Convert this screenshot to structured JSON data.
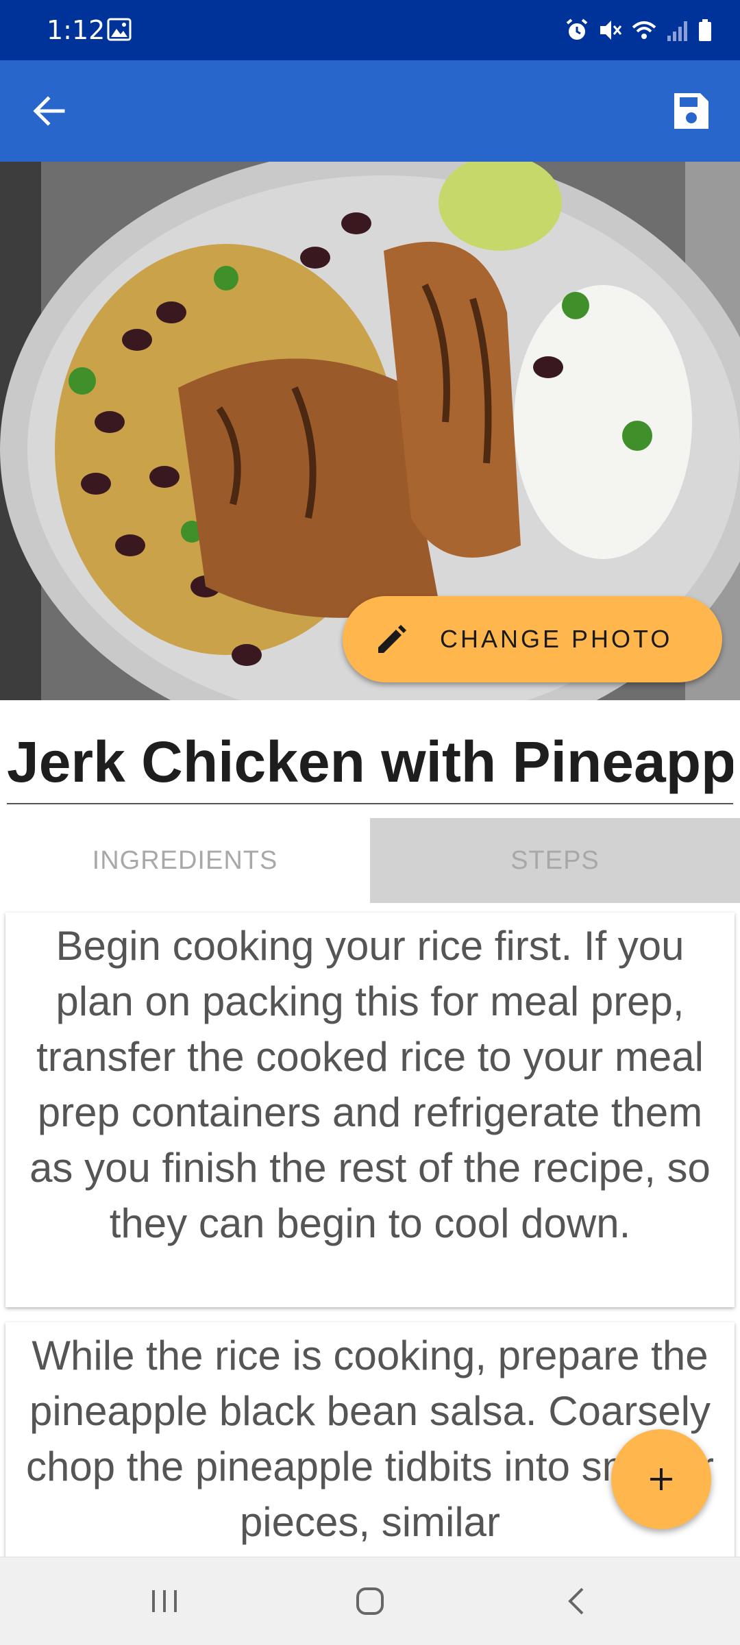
{
  "status_bar": {
    "time": "1:12",
    "icons": [
      "gallery-icon",
      "alarm-icon",
      "mute-icon",
      "wifi-icon",
      "signal-icon",
      "battery-icon"
    ],
    "background": "#003399"
  },
  "app_bar": {
    "back_icon": "arrow-back-icon",
    "save_icon": "save-icon",
    "background": "#2866cc"
  },
  "hero": {
    "change_photo_label": "CHANGE PHOTO",
    "change_photo_icon": "pencil-icon",
    "accent": "#ffb74d"
  },
  "recipe": {
    "title": "Jerk Chicken with Pineapple Black Bean Salsa"
  },
  "tabs": [
    {
      "label": "INGREDIENTS",
      "selected": false
    },
    {
      "label": "STEPS",
      "selected": true
    }
  ],
  "steps": [
    {
      "text": "Begin cooking your rice first. If you plan on packing this for meal prep, transfer the cooked rice to your meal prep containers and refrigerate them as you finish the rest of the recipe, so they can begin to cool down."
    },
    {
      "text": "While the rice is cooking, prepare the pineapple black bean salsa. Coarsely chop the pineapple tidbits into smaller pieces, similar"
    }
  ],
  "fab": {
    "icon": "plus-icon"
  },
  "nav_bar": {
    "icons": [
      "recents-icon",
      "home-icon",
      "back-nav-icon"
    ]
  }
}
